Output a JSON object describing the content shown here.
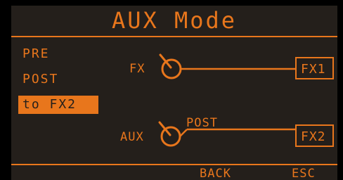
{
  "header": {
    "title": "AUX Mode"
  },
  "menu": {
    "items": [
      {
        "label": "PRE",
        "selected": false
      },
      {
        "label": "POST",
        "selected": false
      },
      {
        "label": "to FX2",
        "selected": true
      }
    ]
  },
  "diagram": {
    "fx_label": "FX",
    "fx_output": "FX1",
    "aux_label": "AUX",
    "aux_tap": "POST",
    "aux_output": "FX2",
    "knob_icon": "knob-icon"
  },
  "softkeys": {
    "back_label": "BACK",
    "esc_label": "ESC"
  },
  "colors": {
    "accent": "#e8761c",
    "background": "#241f1b",
    "frame": "#000000"
  }
}
